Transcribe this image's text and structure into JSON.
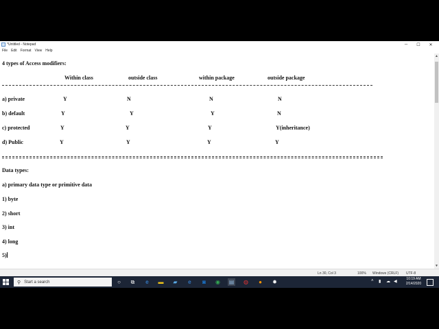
{
  "window": {
    "title": "*Untitled - Notepad",
    "min_glyph": "─",
    "max_glyph": "☐",
    "close_glyph": "✕"
  },
  "menu": [
    "File",
    "Edit",
    "Format",
    "View",
    "Help"
  ],
  "editor": {
    "heading": "4 types of Access modifiers:",
    "table_headers": [
      "Within class",
      "outside class",
      "within package",
      "outside package"
    ],
    "rule1": "------------------------------------------------------------------------------------------------------------------------------------------------------------",
    "rows": [
      {
        "label": "a) private",
        "cells": [
          "Y",
          "N",
          "N",
          "N"
        ]
      },
      {
        "label": "b) default",
        "cells": [
          "Y",
          "Y",
          "Y",
          "N"
        ]
      },
      {
        "label": "c) protected",
        "cells": [
          "Y",
          "Y",
          "Y",
          "Y(inheritance)"
        ]
      },
      {
        "label": "d) Public",
        "cells": [
          "Y",
          "Y",
          "Y",
          "Y"
        ]
      }
    ],
    "rule2": "===============================================================================================================",
    "data_types_heading": "Data types:",
    "primary_heading": "a) primary data type or primitive data",
    "types": [
      "1) byte",
      "2) short",
      "3) int",
      "4) long",
      "5)"
    ]
  },
  "statusbar": {
    "position": "Ln 30, Col 3",
    "zoom": "100%",
    "eol": "Windows (CRLF)",
    "encoding": "UTF-8"
  },
  "taskbar": {
    "search_placeholder": "Start a search",
    "time": "10:19 AM",
    "date": "2/14/2020",
    "icons": [
      "task-view-icon",
      "file-explorer-icon",
      "edge-icon",
      "explorer-icon",
      "store-icon",
      "ie-icon",
      "outlook-icon",
      "chrome-icon",
      "notepad-icon",
      "ftp-icon",
      "firefox-icon",
      "settings-icon"
    ]
  }
}
